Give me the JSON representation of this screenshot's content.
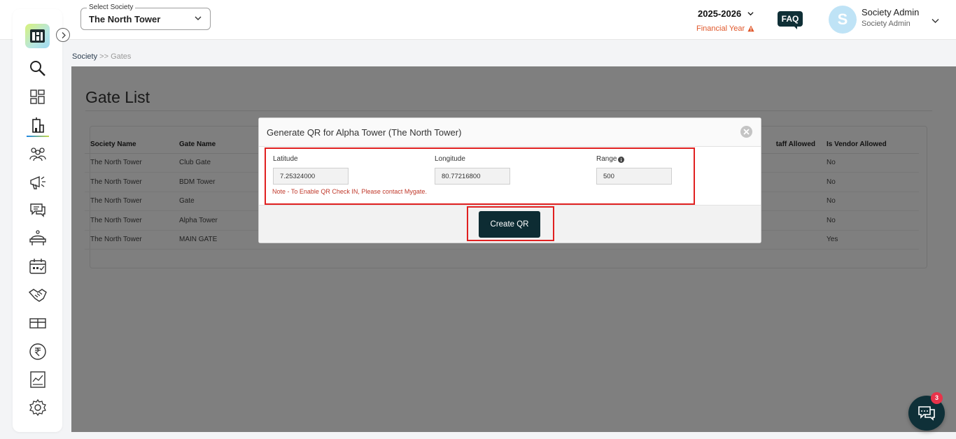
{
  "header": {
    "society_select": {
      "legend": "Select Society",
      "value": "The North Tower"
    },
    "financial_year": {
      "year": "2025-2026",
      "label": "Financial Year"
    },
    "faq_label": "FAQ",
    "user": {
      "initial": "S",
      "name": "Society Admin",
      "role": "Society Admin"
    }
  },
  "sidebar": {
    "items": [
      "search-icon",
      "dashboard-icon",
      "building-icon",
      "residents-icon",
      "announcement-icon",
      "chat-icon",
      "amenity-icon",
      "calendar-icon",
      "handshake-icon",
      "gate-icon",
      "rupee-icon",
      "report-icon",
      "settings-icon"
    ],
    "active": "building-icon"
  },
  "breadcrumb": {
    "root": "Society",
    "separator": ">>",
    "current": "Gates"
  },
  "page": {
    "title": "Gate List",
    "table": {
      "columns": [
        "Society Name",
        "Gate Name",
        "",
        "",
        "taff Allowed",
        "Is Vendor Allowed"
      ],
      "rows": [
        [
          "The North Tower",
          "Club Gate",
          "No"
        ],
        [
          "The North Tower",
          "BDM Tower",
          "No"
        ],
        [
          "The North Tower",
          "Gate",
          "No"
        ],
        [
          "The North Tower",
          "Alpha Tower",
          "No"
        ],
        [
          "The North Tower",
          "MAIN GATE",
          "Yes"
        ]
      ]
    }
  },
  "modal": {
    "title": "Generate QR for Alpha Tower (The North Tower)",
    "latitude": {
      "label": "Latitude",
      "value": "7.25324000"
    },
    "longitude": {
      "label": "Longitude",
      "value": "80.77216800"
    },
    "range": {
      "label": "Range",
      "value": "500"
    },
    "note": "Note - To Enable QR Check IN, Please contact Mygate.",
    "create_button": "Create QR"
  },
  "chat_widget": {
    "badge_count": "3"
  },
  "colors": {
    "accent": "#0d2c33",
    "highlight": "#e02020",
    "warning": "#e0572a"
  }
}
